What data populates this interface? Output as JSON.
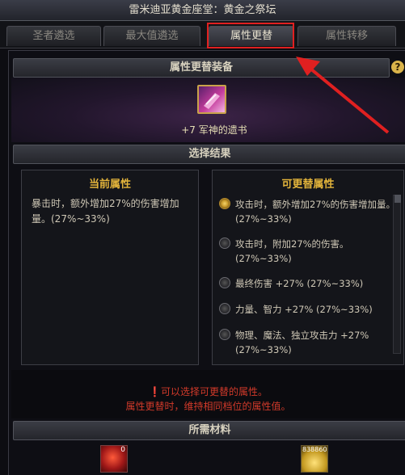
{
  "window": {
    "title": "雷米迪亚黄金座堂：黄金之祭坛"
  },
  "tabs": [
    {
      "label": "圣者遴选",
      "active": false
    },
    {
      "label": "最大值遴选",
      "active": false
    },
    {
      "label": "属性更替",
      "active": true
    },
    {
      "label": "属性转移",
      "active": false
    }
  ],
  "equip": {
    "header": "属性更替装备",
    "item_name": "+7 军神的遗书",
    "item_icon": "book-icon"
  },
  "help": {
    "label": "?"
  },
  "result": {
    "header": "选择结果",
    "current": {
      "title": "当前属性",
      "text": "暴击时，额外增加27%的伤害增加量。(27%~33%)"
    },
    "replaceable": {
      "title": "可更替属性",
      "options": [
        {
          "text": "攻击时，额外增加27%的伤害增加量。(27%~33%)",
          "selected": true
        },
        {
          "text": "攻击时，附加27%的伤害。(27%~33%)",
          "selected": false
        },
        {
          "text": "最终伤害 +27% (27%~33%)",
          "selected": false
        },
        {
          "text": "力量、智力 +27% (27%~33%)",
          "selected": false
        },
        {
          "text": "物理、魔法、独立攻击力 +27% (27%~33%)",
          "selected": false
        }
      ]
    }
  },
  "notice": {
    "line1": "❗可以选择可更替的属性。",
    "line2": "属性更替时，维持相同档位的属性值。"
  },
  "materials": {
    "header": "所需材料",
    "items": [
      {
        "count": "0",
        "icon": "red-orb-icon"
      },
      {
        "count": "838860",
        "icon": "gold-coins-icon"
      }
    ]
  },
  "colors": {
    "accent_gold": "#e3b43b",
    "warning_red": "#d23a2a",
    "highlight": "#e02020"
  }
}
